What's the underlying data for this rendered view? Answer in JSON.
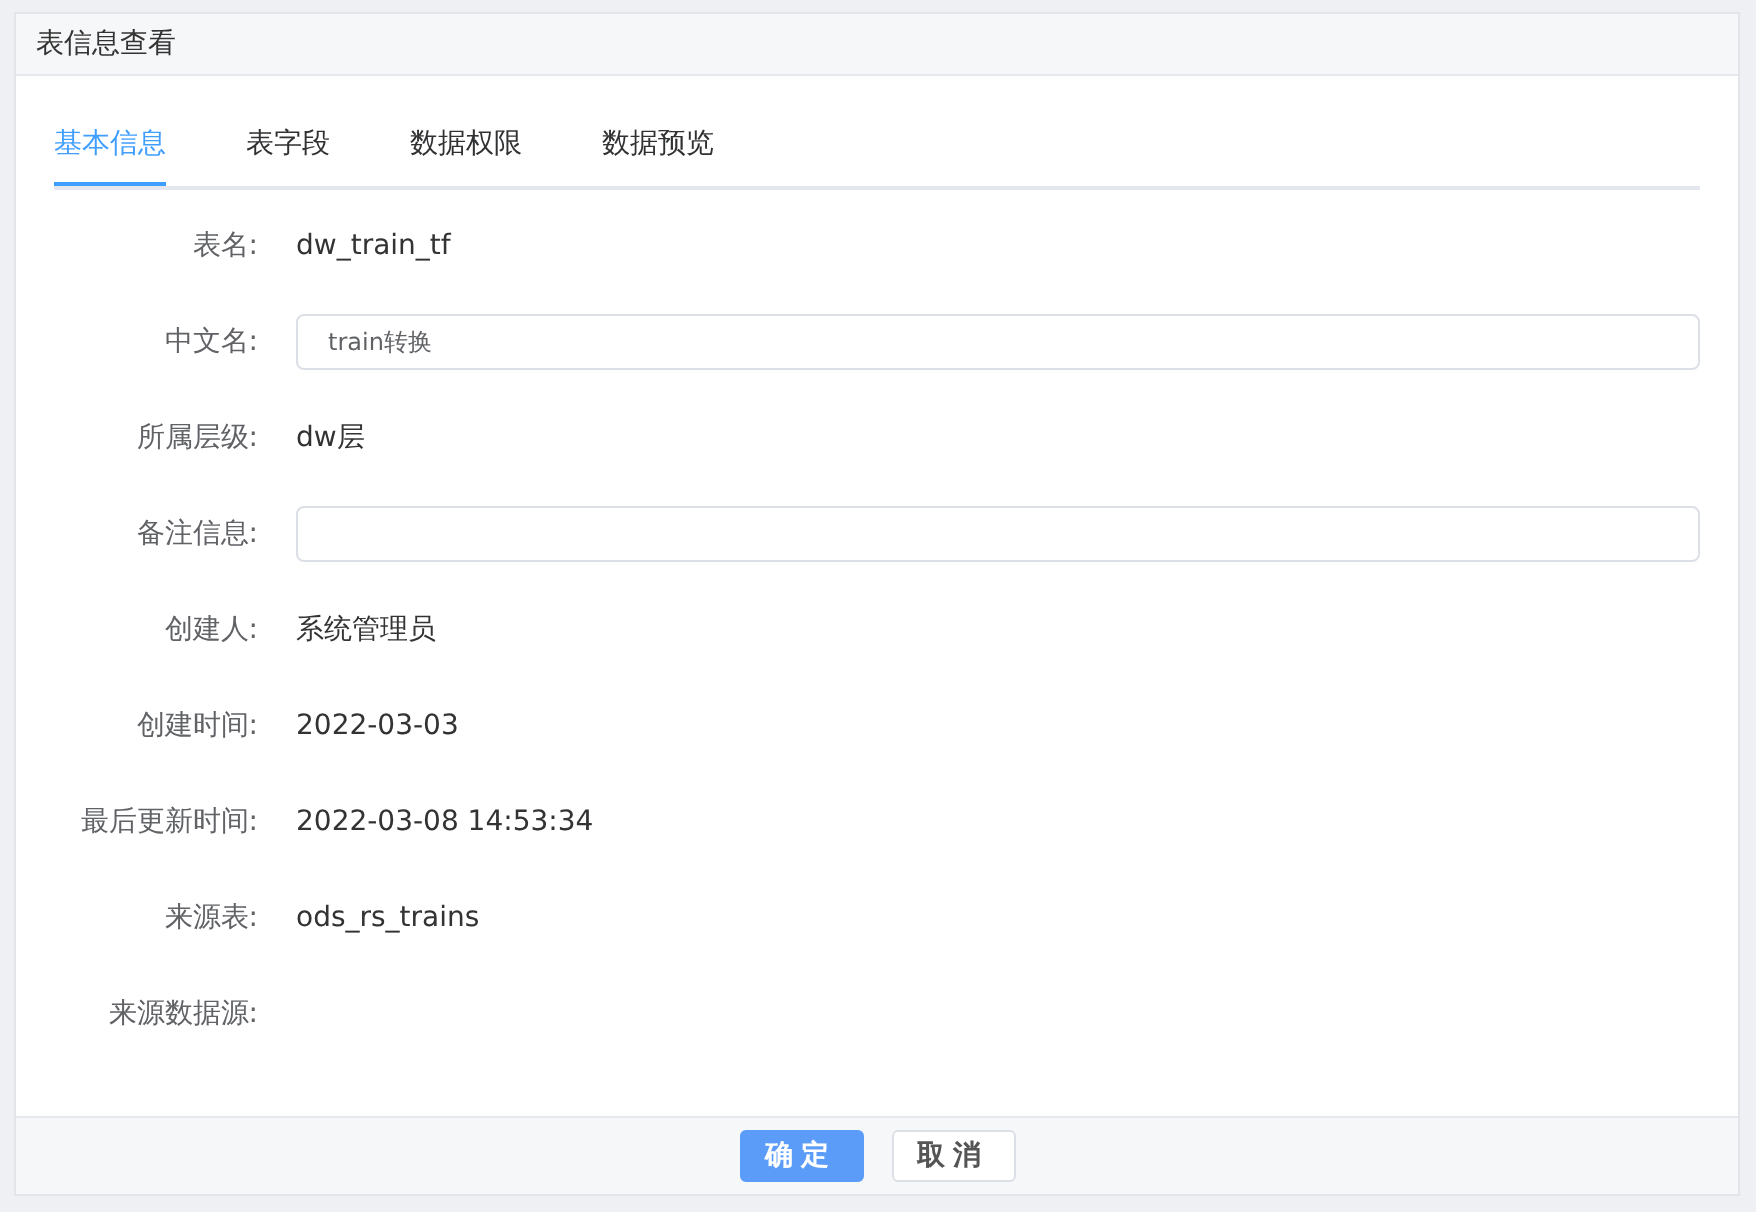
{
  "dialog": {
    "title": "表信息查看"
  },
  "tabs": [
    {
      "label": "基本信息",
      "selected": true
    },
    {
      "label": "表字段",
      "selected": false
    },
    {
      "label": "数据权限",
      "selected": false
    },
    {
      "label": "数据预览",
      "selected": false
    }
  ],
  "fields": [
    {
      "label": "表名:",
      "kind": "text",
      "value": "dw_train_tf"
    },
    {
      "label": "中文名:",
      "kind": "input",
      "value": "train转换"
    },
    {
      "label": "所属层级:",
      "kind": "text",
      "value": "dw层"
    },
    {
      "label": "备注信息:",
      "kind": "input"
    },
    {
      "label": "创建人:",
      "kind": "text",
      "value": "系统管理员"
    },
    {
      "label": "创建时间:",
      "kind": "text",
      "value": "2022-03-03"
    },
    {
      "label": "最后更新时间:",
      "kind": "text",
      "value": "2022-03-08 14:53:34"
    },
    {
      "label": "来源表:",
      "kind": "text",
      "value": "ods_rs_trains"
    },
    {
      "label": "来源数据源:",
      "kind": "text"
    }
  ],
  "buttons": [
    {
      "label": "确定",
      "kind": "primary"
    },
    {
      "label": "取消",
      "kind": "default"
    }
  ]
}
